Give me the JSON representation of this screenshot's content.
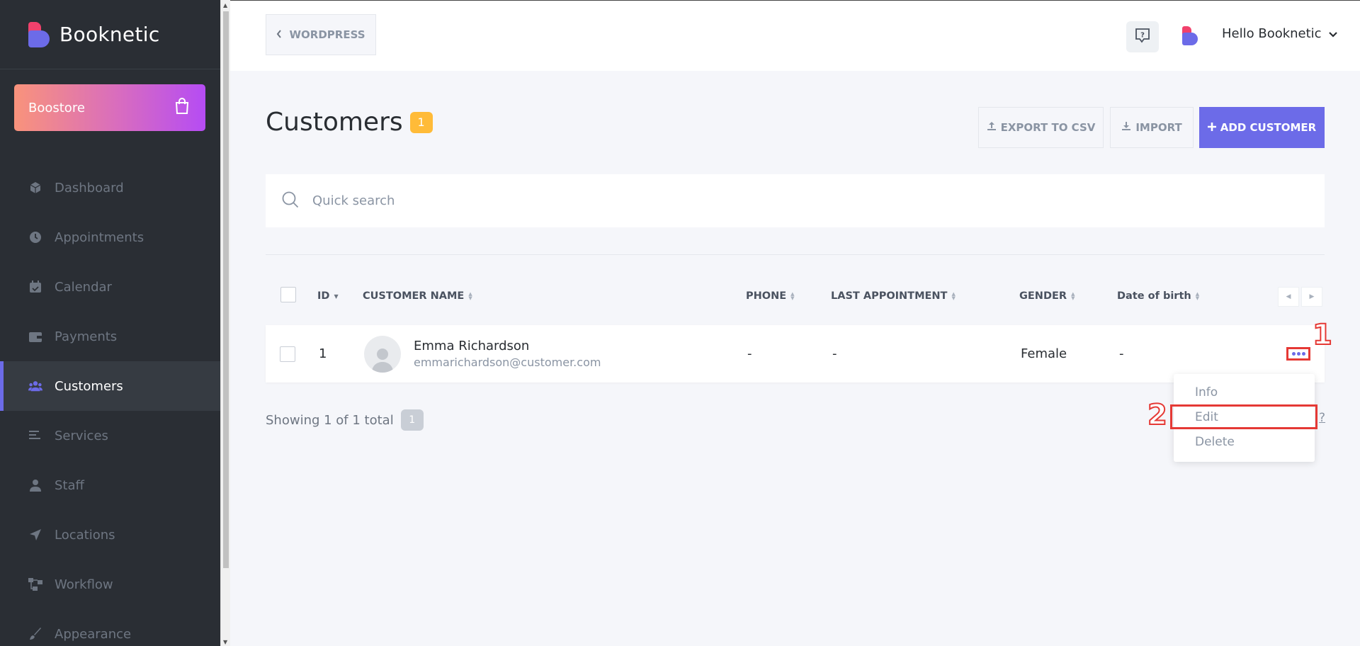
{
  "brand": {
    "name": "Booknetic"
  },
  "boostore": {
    "label": "Boostore",
    "icon": "shopping-bag-icon"
  },
  "sidebar": {
    "items": [
      {
        "label": "Dashboard",
        "icon": "cube-icon"
      },
      {
        "label": "Appointments",
        "icon": "clock-icon"
      },
      {
        "label": "Calendar",
        "icon": "calendar-icon"
      },
      {
        "label": "Payments",
        "icon": "wallet-icon"
      },
      {
        "label": "Customers",
        "icon": "users-icon",
        "active": true
      },
      {
        "label": "Services",
        "icon": "list-icon"
      },
      {
        "label": "Staff",
        "icon": "user-icon"
      },
      {
        "label": "Locations",
        "icon": "location-arrow-icon"
      },
      {
        "label": "Workflow",
        "icon": "workflow-icon"
      },
      {
        "label": "Appearance",
        "icon": "brush-icon"
      }
    ]
  },
  "topbar": {
    "back_label": "WORDPRESS",
    "user_greeting": "Hello Booknetic"
  },
  "page": {
    "title": "Customers",
    "count": "1"
  },
  "actions": {
    "export_label": "EXPORT TO CSV",
    "import_label": "IMPORT",
    "add_label": "ADD CUSTOMER"
  },
  "search": {
    "placeholder": "Quick search",
    "value": ""
  },
  "table": {
    "columns": [
      "ID",
      "CUSTOMER NAME",
      "PHONE",
      "LAST APPOINTMENT",
      "GENDER",
      "Date of birth"
    ],
    "rows": [
      {
        "id": "1",
        "name": "Emma Richardson",
        "email": "emmarichardson@customer.com",
        "phone": "-",
        "last_appointment": "-",
        "gender": "Female",
        "dob": "-"
      }
    ]
  },
  "row_menu": {
    "items": [
      "Info",
      "Edit",
      "Delete"
    ]
  },
  "footer": {
    "showing_text": "Showing 1 of 1 total",
    "page": "1",
    "help": "?"
  },
  "annotations": {
    "marker_1": "1",
    "marker_2": "2"
  },
  "colors": {
    "accent": "#6c6be8",
    "sidebar": "#2a2e34",
    "badge": "#ffbb38",
    "annotation": "#e53935"
  }
}
